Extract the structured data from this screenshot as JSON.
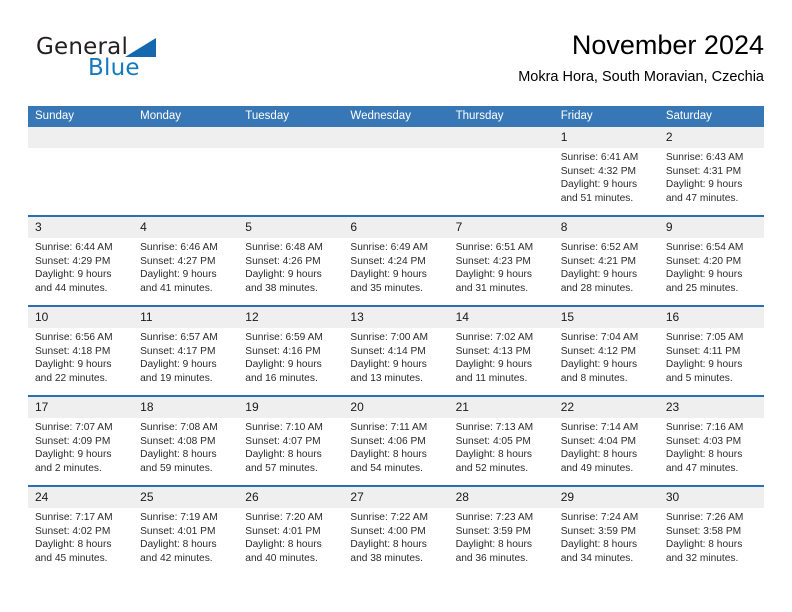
{
  "brand": {
    "name_top": "General",
    "name_bottom": "Blue",
    "triangle_icon": "triangle-icon",
    "color_dark": "#231f20",
    "color_blue": "#1479bf"
  },
  "header": {
    "title": "November 2024",
    "subtitle": "Mokra Hora, South Moravian, Czechia"
  },
  "theme": {
    "header_bg": "#3877b5",
    "row_divider": "#2a6fb0",
    "daynum_bg": "#efefef",
    "text": "#2b2b2b"
  },
  "weekdays": [
    "Sunday",
    "Monday",
    "Tuesday",
    "Wednesday",
    "Thursday",
    "Friday",
    "Saturday"
  ],
  "labels": {
    "sunrise_prefix": "Sunrise:",
    "sunset_prefix": "Sunset:",
    "daylight_prefix": "Daylight:"
  },
  "weeks": [
    [
      {
        "day": "",
        "line1": "",
        "line2": "",
        "line3": "",
        "line4": ""
      },
      {
        "day": "",
        "line1": "",
        "line2": "",
        "line3": "",
        "line4": ""
      },
      {
        "day": "",
        "line1": "",
        "line2": "",
        "line3": "",
        "line4": ""
      },
      {
        "day": "",
        "line1": "",
        "line2": "",
        "line3": "",
        "line4": ""
      },
      {
        "day": "",
        "line1": "",
        "line2": "",
        "line3": "",
        "line4": ""
      },
      {
        "day": "1",
        "line1": "Sunrise: 6:41 AM",
        "line2": "Sunset: 4:32 PM",
        "line3": "Daylight: 9 hours",
        "line4": "and 51 minutes."
      },
      {
        "day": "2",
        "line1": "Sunrise: 6:43 AM",
        "line2": "Sunset: 4:31 PM",
        "line3": "Daylight: 9 hours",
        "line4": "and 47 minutes."
      }
    ],
    [
      {
        "day": "3",
        "line1": "Sunrise: 6:44 AM",
        "line2": "Sunset: 4:29 PM",
        "line3": "Daylight: 9 hours",
        "line4": "and 44 minutes."
      },
      {
        "day": "4",
        "line1": "Sunrise: 6:46 AM",
        "line2": "Sunset: 4:27 PM",
        "line3": "Daylight: 9 hours",
        "line4": "and 41 minutes."
      },
      {
        "day": "5",
        "line1": "Sunrise: 6:48 AM",
        "line2": "Sunset: 4:26 PM",
        "line3": "Daylight: 9 hours",
        "line4": "and 38 minutes."
      },
      {
        "day": "6",
        "line1": "Sunrise: 6:49 AM",
        "line2": "Sunset: 4:24 PM",
        "line3": "Daylight: 9 hours",
        "line4": "and 35 minutes."
      },
      {
        "day": "7",
        "line1": "Sunrise: 6:51 AM",
        "line2": "Sunset: 4:23 PM",
        "line3": "Daylight: 9 hours",
        "line4": "and 31 minutes."
      },
      {
        "day": "8",
        "line1": "Sunrise: 6:52 AM",
        "line2": "Sunset: 4:21 PM",
        "line3": "Daylight: 9 hours",
        "line4": "and 28 minutes."
      },
      {
        "day": "9",
        "line1": "Sunrise: 6:54 AM",
        "line2": "Sunset: 4:20 PM",
        "line3": "Daylight: 9 hours",
        "line4": "and 25 minutes."
      }
    ],
    [
      {
        "day": "10",
        "line1": "Sunrise: 6:56 AM",
        "line2": "Sunset: 4:18 PM",
        "line3": "Daylight: 9 hours",
        "line4": "and 22 minutes."
      },
      {
        "day": "11",
        "line1": "Sunrise: 6:57 AM",
        "line2": "Sunset: 4:17 PM",
        "line3": "Daylight: 9 hours",
        "line4": "and 19 minutes."
      },
      {
        "day": "12",
        "line1": "Sunrise: 6:59 AM",
        "line2": "Sunset: 4:16 PM",
        "line3": "Daylight: 9 hours",
        "line4": "and 16 minutes."
      },
      {
        "day": "13",
        "line1": "Sunrise: 7:00 AM",
        "line2": "Sunset: 4:14 PM",
        "line3": "Daylight: 9 hours",
        "line4": "and 13 minutes."
      },
      {
        "day": "14",
        "line1": "Sunrise: 7:02 AM",
        "line2": "Sunset: 4:13 PM",
        "line3": "Daylight: 9 hours",
        "line4": "and 11 minutes."
      },
      {
        "day": "15",
        "line1": "Sunrise: 7:04 AM",
        "line2": "Sunset: 4:12 PM",
        "line3": "Daylight: 9 hours",
        "line4": "and 8 minutes."
      },
      {
        "day": "16",
        "line1": "Sunrise: 7:05 AM",
        "line2": "Sunset: 4:11 PM",
        "line3": "Daylight: 9 hours",
        "line4": "and 5 minutes."
      }
    ],
    [
      {
        "day": "17",
        "line1": "Sunrise: 7:07 AM",
        "line2": "Sunset: 4:09 PM",
        "line3": "Daylight: 9 hours",
        "line4": "and 2 minutes."
      },
      {
        "day": "18",
        "line1": "Sunrise: 7:08 AM",
        "line2": "Sunset: 4:08 PM",
        "line3": "Daylight: 8 hours",
        "line4": "and 59 minutes."
      },
      {
        "day": "19",
        "line1": "Sunrise: 7:10 AM",
        "line2": "Sunset: 4:07 PM",
        "line3": "Daylight: 8 hours",
        "line4": "and 57 minutes."
      },
      {
        "day": "20",
        "line1": "Sunrise: 7:11 AM",
        "line2": "Sunset: 4:06 PM",
        "line3": "Daylight: 8 hours",
        "line4": "and 54 minutes."
      },
      {
        "day": "21",
        "line1": "Sunrise: 7:13 AM",
        "line2": "Sunset: 4:05 PM",
        "line3": "Daylight: 8 hours",
        "line4": "and 52 minutes."
      },
      {
        "day": "22",
        "line1": "Sunrise: 7:14 AM",
        "line2": "Sunset: 4:04 PM",
        "line3": "Daylight: 8 hours",
        "line4": "and 49 minutes."
      },
      {
        "day": "23",
        "line1": "Sunrise: 7:16 AM",
        "line2": "Sunset: 4:03 PM",
        "line3": "Daylight: 8 hours",
        "line4": "and 47 minutes."
      }
    ],
    [
      {
        "day": "24",
        "line1": "Sunrise: 7:17 AM",
        "line2": "Sunset: 4:02 PM",
        "line3": "Daylight: 8 hours",
        "line4": "and 45 minutes."
      },
      {
        "day": "25",
        "line1": "Sunrise: 7:19 AM",
        "line2": "Sunset: 4:01 PM",
        "line3": "Daylight: 8 hours",
        "line4": "and 42 minutes."
      },
      {
        "day": "26",
        "line1": "Sunrise: 7:20 AM",
        "line2": "Sunset: 4:01 PM",
        "line3": "Daylight: 8 hours",
        "line4": "and 40 minutes."
      },
      {
        "day": "27",
        "line1": "Sunrise: 7:22 AM",
        "line2": "Sunset: 4:00 PM",
        "line3": "Daylight: 8 hours",
        "line4": "and 38 minutes."
      },
      {
        "day": "28",
        "line1": "Sunrise: 7:23 AM",
        "line2": "Sunset: 3:59 PM",
        "line3": "Daylight: 8 hours",
        "line4": "and 36 minutes."
      },
      {
        "day": "29",
        "line1": "Sunrise: 7:24 AM",
        "line2": "Sunset: 3:59 PM",
        "line3": "Daylight: 8 hours",
        "line4": "and 34 minutes."
      },
      {
        "day": "30",
        "line1": "Sunrise: 7:26 AM",
        "line2": "Sunset: 3:58 PM",
        "line3": "Daylight: 8 hours",
        "line4": "and 32 minutes."
      }
    ]
  ]
}
